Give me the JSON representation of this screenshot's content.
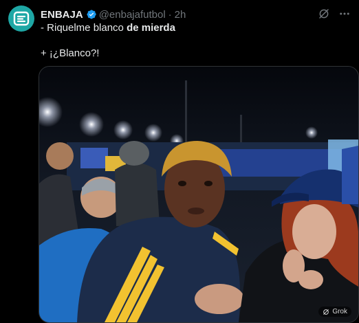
{
  "author": {
    "display_name": "ENBAJA",
    "handle": "@enbajafutbol",
    "separator": "·",
    "timestamp": "2h",
    "verified": true
  },
  "tweet": {
    "line1_prefix": "- Riquelme blanco ",
    "line1_bold": "de mierda",
    "line2": "+ ¡¿Blanco?!"
  },
  "media": {
    "type": "video",
    "grok_label": "Grok"
  },
  "colors": {
    "avatar_bg": "#1ea7a5",
    "verified": "#1d9bf0",
    "secondary_text": "#71767b",
    "boca_blue": "#1c3f8a",
    "boca_gold": "#f2c230"
  },
  "icons": {
    "header_action": "grok-slash-icon",
    "menu": "more-dots-icon"
  }
}
